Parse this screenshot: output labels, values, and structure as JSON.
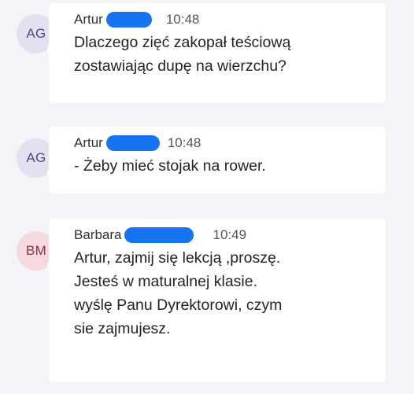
{
  "messages": [
    {
      "initials": "AG",
      "author": "Artur",
      "time": "10:48",
      "lines": [
        "Dlaczego zięć zakopał teściową",
        "zostawiając dupę na wierzchu?"
      ]
    },
    {
      "initials": "AG",
      "author": "Artur",
      "time": "10:48",
      "lines": [
        "- Żeby mieć stojak na rower."
      ]
    },
    {
      "initials": "BM",
      "author": "Barbara",
      "time": "10:49",
      "lines": [
        "Artur, zajmij się lekcją ,proszę.",
        "Jesteś w maturalnej klasie.",
        "wyślę Panu Dyrektorowi, czym",
        "sie zajmujesz."
      ]
    }
  ],
  "colors": {
    "background": "#f4f3f7",
    "bubble": "#ffffff",
    "redaction": "#1673f2",
    "avatar_ag": "#e3e1ef",
    "avatar_bm": "#f6d9de"
  },
  "icons": {
    "status": "status-offline-icon",
    "redaction": "redaction-scribble"
  }
}
